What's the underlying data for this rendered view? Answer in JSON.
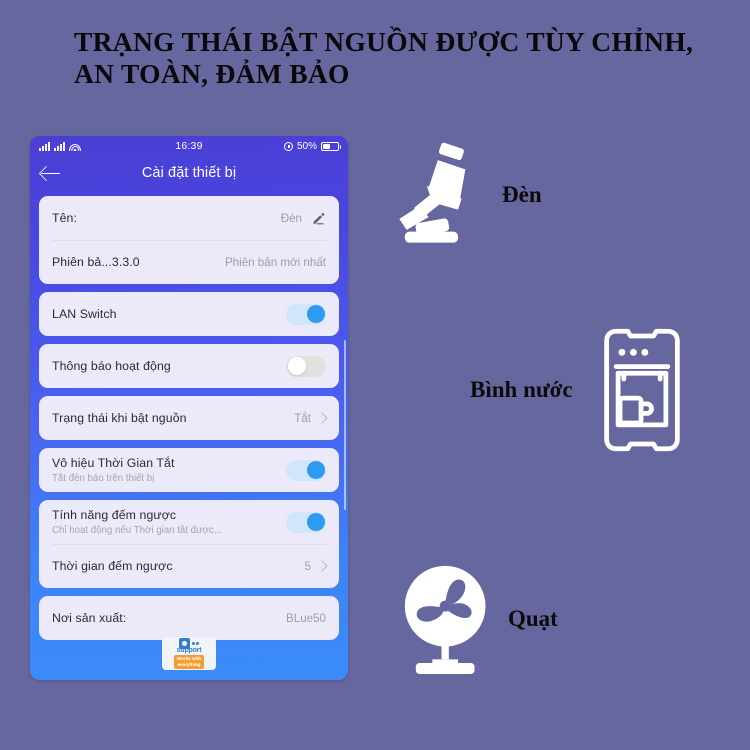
{
  "headline": {
    "line1": "TRẠNG THÁI BẬT NGUỒN ĐƯỢC TÙY CHỈNH,",
    "line2": "AN TOÀN, ĐẢM BẢO"
  },
  "phone": {
    "status_bar": {
      "time": "16:39",
      "battery_percent": "50%",
      "signal_icon": "signal-bars-icon",
      "wifi_icon": "wifi-icon",
      "alarm_icon": "alarm-icon",
      "battery_icon": "battery-icon"
    },
    "nav": {
      "back_icon": "back-arrow-icon",
      "title": "Cài đặt thiết bị"
    },
    "cards": [
      {
        "rows": [
          {
            "title": "Tên:",
            "value": "Đèn",
            "accessory": "pencil-icon"
          },
          {
            "title": "Phiên bả...3.3.0",
            "value": "Phiên bản mới nhất",
            "accessory": "none"
          }
        ]
      },
      {
        "rows": [
          {
            "title": "LAN Switch",
            "accessory": "toggle",
            "toggle": "on"
          }
        ]
      },
      {
        "rows": [
          {
            "title": "Thông báo hoạt động",
            "accessory": "toggle",
            "toggle": "off"
          }
        ]
      },
      {
        "rows": [
          {
            "title": "Trạng thái khi bật nguồn",
            "value": "Tắt",
            "accessory": "chevron"
          }
        ]
      },
      {
        "rows": [
          {
            "title": " Vô hiệu Thời Gian Tắt",
            "sub": "Tắt đèn báo trên thiết bị",
            "accessory": "toggle",
            "toggle": "on"
          }
        ]
      },
      {
        "rows": [
          {
            "title": "Tính năng đếm ngược",
            "sub": "Chỉ hoạt động nếu Thời gian tắt được...",
            "accessory": "toggle",
            "toggle": "on"
          },
          {
            "title": "Thời gian đếm ngược",
            "value": "5",
            "accessory": "chevron"
          }
        ]
      },
      {
        "rows": [
          {
            "title": "Nơi sản xuất:",
            "value": "BLue50",
            "accessory": "none"
          }
        ]
      }
    ],
    "badge": {
      "word": "support",
      "tag_line1": "Works with",
      "tag_line2": "everything"
    }
  },
  "illustrations": [
    {
      "id": "lamp",
      "icon": "desk-lamp-icon",
      "caption": "Đèn"
    },
    {
      "id": "water",
      "icon": "water-dispenser-icon",
      "caption": "Bình nước"
    },
    {
      "id": "fan",
      "icon": "electric-fan-icon",
      "caption": "Quạt"
    }
  ],
  "colors": {
    "background": "#66679f",
    "phone_top": "#4a3fd4",
    "phone_bottom": "#3b8bf9",
    "toggle_on": "#2e9bf0",
    "card": "#eceaf8",
    "badge_orange": "#f0a030"
  }
}
